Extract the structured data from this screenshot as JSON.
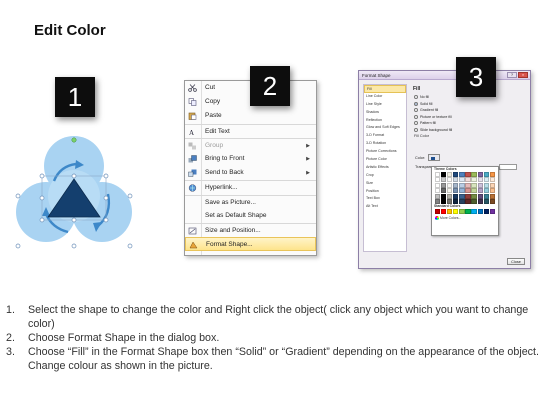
{
  "page": {
    "title": "Edit Color"
  },
  "badges": [
    "1",
    "2",
    "3"
  ],
  "context_menu": {
    "items": [
      {
        "label": "Cut",
        "icon": "scissors-icon",
        "submenu": false,
        "disabled": false,
        "highlighted": false
      },
      {
        "label": "Copy",
        "icon": "copy-icon",
        "submenu": false,
        "disabled": false,
        "highlighted": false
      },
      {
        "label": "Paste",
        "icon": "paste-icon",
        "submenu": false,
        "disabled": false,
        "highlighted": false
      },
      {
        "label": "Edit Text",
        "icon": "edit-text-icon",
        "submenu": false,
        "disabled": false,
        "highlighted": false
      },
      {
        "label": "Group",
        "icon": "group-icon",
        "submenu": true,
        "disabled": true,
        "highlighted": false
      },
      {
        "label": "Bring to Front",
        "icon": "bring-to-front-icon",
        "submenu": true,
        "disabled": false,
        "highlighted": false
      },
      {
        "label": "Send to Back",
        "icon": "send-to-back-icon",
        "submenu": true,
        "disabled": false,
        "highlighted": false
      },
      {
        "label": "Hyperlink...",
        "icon": "hyperlink-icon",
        "submenu": false,
        "disabled": false,
        "highlighted": false
      },
      {
        "label": "Save as Picture...",
        "icon": "",
        "submenu": false,
        "disabled": false,
        "highlighted": false
      },
      {
        "label": "Set as Default Shape",
        "icon": "",
        "submenu": false,
        "disabled": false,
        "highlighted": false
      },
      {
        "label": "Size and Position...",
        "icon": "size-position-icon",
        "submenu": false,
        "disabled": false,
        "highlighted": false
      },
      {
        "label": "Format Shape...",
        "icon": "format-shape-icon",
        "submenu": false,
        "disabled": false,
        "highlighted": true
      }
    ]
  },
  "format_dialog": {
    "title": "Format Shape",
    "nav_items": [
      "Fill",
      "Line Color",
      "Line Style",
      "Shadow",
      "Reflection",
      "Glow and Soft Edges",
      "3-D Format",
      "3-D Rotation",
      "Picture Corrections",
      "Picture Color",
      "Artistic Effects",
      "Crop",
      "Size",
      "Position",
      "Text Box",
      "Alt Text"
    ],
    "active_nav": "Fill",
    "fill_heading": "Fill",
    "fill_options": [
      {
        "label": "No fill",
        "checked": false
      },
      {
        "label": "Solid fill",
        "checked": true
      },
      {
        "label": "Gradient fill",
        "checked": false
      },
      {
        "label": "Picture or texture fill",
        "checked": false
      },
      {
        "label": "Pattern fill",
        "checked": false
      },
      {
        "label": "Slide background fill",
        "checked": false
      }
    ],
    "fill_color_heading": "Fill Color",
    "color_label": "Color:",
    "transparency_label": "Transparency:",
    "palette_theme_label": "Theme Colors",
    "palette_standard_label": "Standard Colors",
    "palette_more": "More Colors...",
    "close_label": "Close",
    "theme_colors": [
      "#ffffff",
      "#000000",
      "#eeece1",
      "#1f497d",
      "#4f81bd",
      "#c0504d",
      "#9bbb59",
      "#8064a2",
      "#4bacc6",
      "#f79646"
    ],
    "standard_colors": [
      "#c00000",
      "#ff0000",
      "#ffc000",
      "#ffff00",
      "#92d050",
      "#00b050",
      "#00b0f0",
      "#0070c0",
      "#002060",
      "#7030a0"
    ]
  },
  "instructions": [
    {
      "num": "1.",
      "text": "Select the shape to change the color and Right click the object( click any object which you want to change color)"
    },
    {
      "num": "2.",
      "text": "Choose Format Shape in the dialog box."
    },
    {
      "num": "3.",
      "text": "Choose “Fill” in the Format Shape box then “Solid” or “Gradient” depending on the appearance of the object. Change colour as shown in the picture."
    }
  ]
}
